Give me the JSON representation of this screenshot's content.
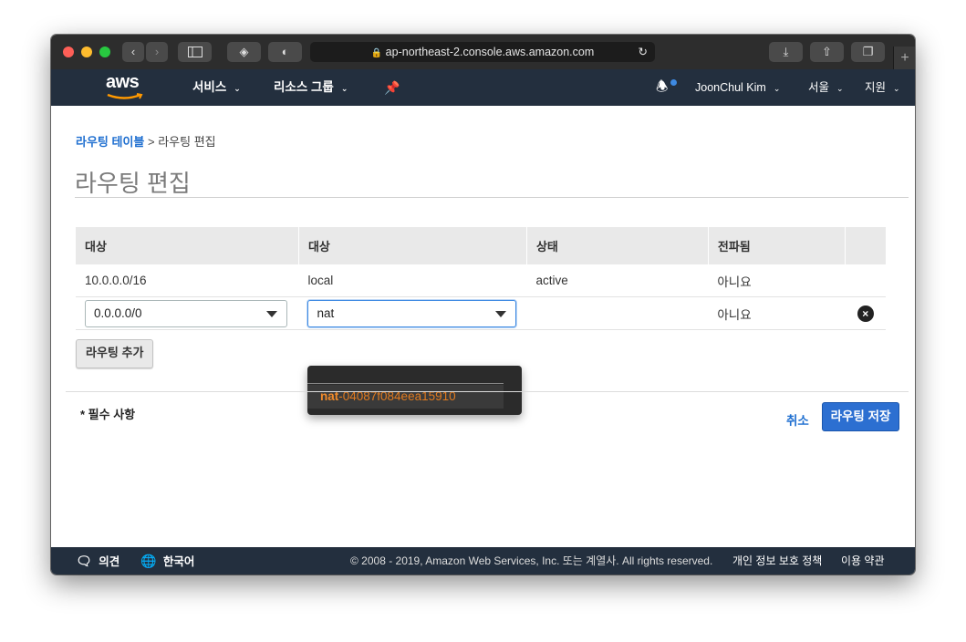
{
  "browser": {
    "url": "ap-northeast-2.console.aws.amazon.com"
  },
  "nav": {
    "logo": "aws",
    "services": "서비스",
    "resource_groups": "리소스 그룹",
    "user": "JoonChul Kim",
    "region": "서울",
    "support": "지원"
  },
  "breadcrumb": {
    "link": "라우팅 테이블",
    "separator": ">",
    "current": "라우팅 편집"
  },
  "page_title": "라우팅 편집",
  "table": {
    "headers": [
      "대상",
      "대상",
      "상태",
      "전파됨"
    ],
    "rows": [
      {
        "destination": "10.0.0.0/16",
        "target": "local",
        "status": "active",
        "propagated": "아니요"
      },
      {
        "destination": "0.0.0.0/0",
        "target": "nat",
        "status": "",
        "propagated": "아니요"
      }
    ]
  },
  "dropdown": {
    "option_prefix": "nat",
    "option_rest": "-04087f084eea15910"
  },
  "add_route_button": "라우팅 추가",
  "required_note": "* 필수 사항",
  "cancel_label": "취소",
  "save_label": "라우팅 저장",
  "footer": {
    "feedback": "의견",
    "language": "한국어",
    "copyright": "© 2008 - 2019, Amazon Web Services, Inc. 또는 계열사. All rights reserved.",
    "privacy": "개인 정보 보호 정책",
    "terms": "이용 약관"
  },
  "colors": {
    "aws_nav": "#232f3e",
    "link_blue": "#1f6fd0",
    "status_active": "#1d8102",
    "primary_button": "#2c6fd1",
    "nat_orange": "#f08a2a"
  }
}
